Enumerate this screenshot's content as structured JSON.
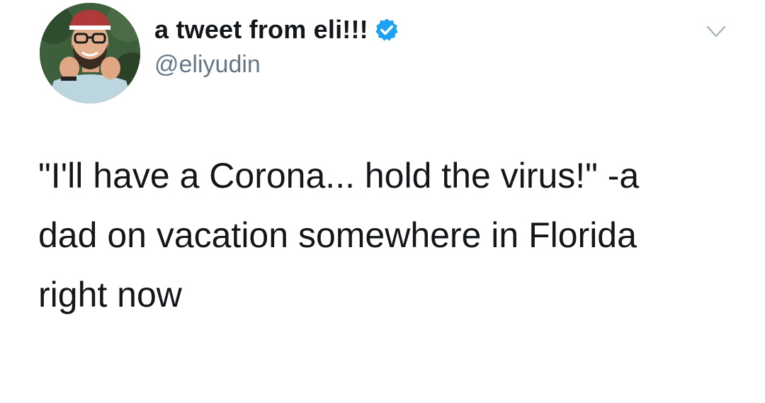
{
  "author": {
    "display_name": "a tweet from eli!!!",
    "handle": "@eliyudin",
    "verified": true,
    "verified_color": "#1da1f2",
    "avatar_icon": "profile-photo"
  },
  "menu": {
    "icon": "chevron-down-icon"
  },
  "tweet": {
    "lines": [
      "\"I'll have a Corona... hold the virus!\" -a",
      "dad on vacation somewhere in Florida",
      "right now"
    ]
  },
  "colors": {
    "text": "#14171a",
    "secondary_text": "#657786",
    "background": "#ffffff"
  }
}
